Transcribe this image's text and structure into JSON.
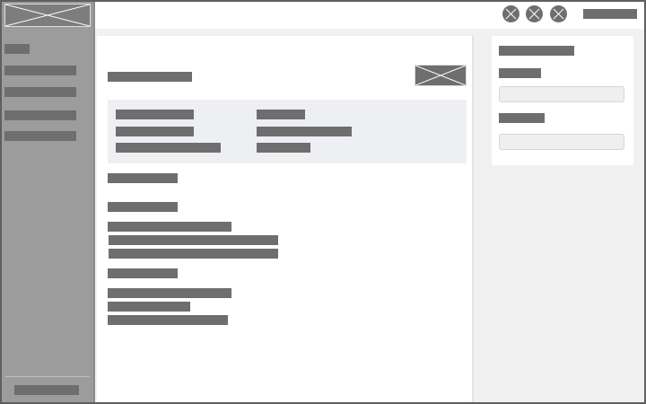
{
  "app": {
    "colors": {
      "frame_border": "#5f5f5f",
      "sidebar_bg": "#9c9c9c",
      "placeholder_block": "#6e6e6e",
      "info_box_bg": "#eeeff3",
      "input_bg": "#efefef",
      "canvas_bg": "#f1f1f1"
    }
  },
  "sidebar": {
    "logo": {
      "icon": "image-placeholder-icon"
    },
    "items": [
      {
        "label": ""
      },
      {
        "label": ""
      },
      {
        "label": ""
      },
      {
        "label": ""
      },
      {
        "label": ""
      }
    ],
    "footer_label": ""
  },
  "topbar": {
    "icons": [
      "circle-icon",
      "circle-icon",
      "circle-icon"
    ],
    "user_label": ""
  },
  "main": {
    "title": "",
    "hero_image": {
      "icon": "image-placeholder-icon"
    },
    "info": {
      "left": [
        "",
        "",
        ""
      ],
      "right": [
        "",
        "",
        ""
      ]
    },
    "section_1_heading": "",
    "section_2_heading": "",
    "section_2_lines": [
      "",
      "",
      ""
    ],
    "section_3_heading": "",
    "section_3_lines": [
      "",
      "",
      ""
    ]
  },
  "right_panel": {
    "title": "",
    "field_1_label": "",
    "field_1_value": "",
    "field_2_label": "",
    "field_2_value": ""
  }
}
